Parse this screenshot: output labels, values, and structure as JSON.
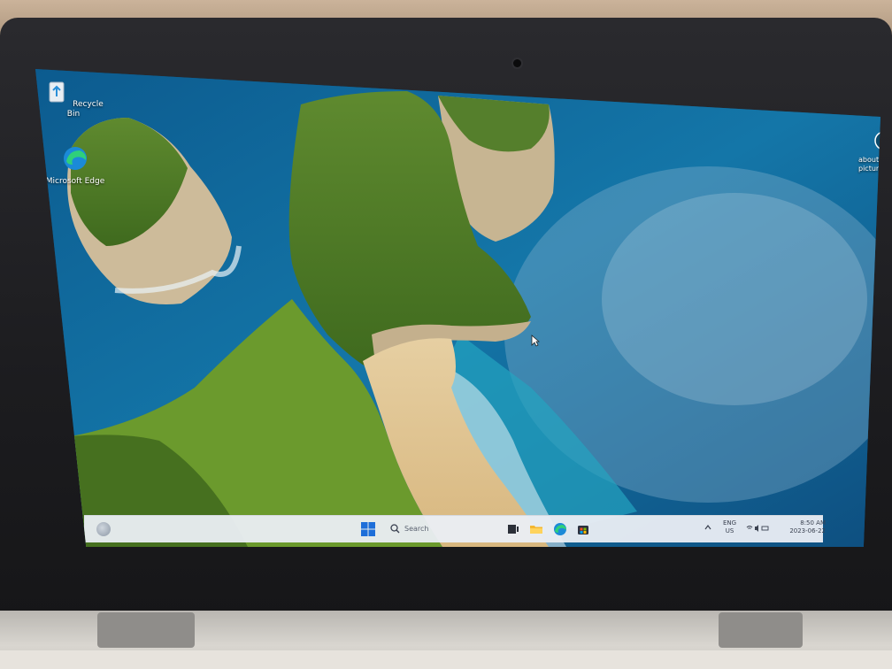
{
  "desktop": {
    "icons": [
      {
        "label": "Recycle Bin",
        "icon": "recycle-bin-icon"
      },
      {
        "label": "Microsoft Edge",
        "icon": "edge-icon"
      }
    ],
    "spotlight": {
      "label": "Learn about this picture",
      "icon": "camera-lens-icon"
    }
  },
  "taskbar": {
    "search_placeholder": "Search",
    "apps": [
      "task-view-icon",
      "file-explorer-icon",
      "edge-icon",
      "store-icon"
    ],
    "tray": {
      "lang_line1": "ENG",
      "lang_line2": "US",
      "time": "8:50 AM",
      "date": "2023-06-22"
    }
  },
  "colors": {
    "taskbar_bg": "#ebeef4",
    "start_blue": "#1e6fd9",
    "folder_yellow": "#f4b731"
  }
}
